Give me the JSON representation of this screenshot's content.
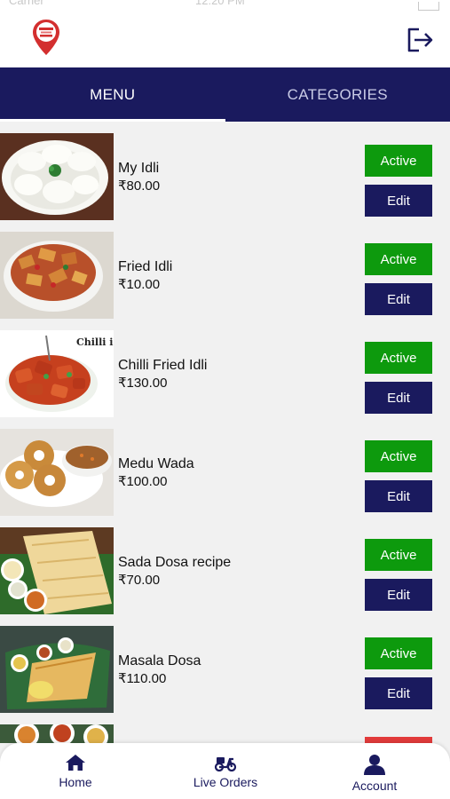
{
  "status_bar": {
    "carrier": "Carrier",
    "time": "12:20 PM"
  },
  "header": {
    "logo_icon": "map-pin-logo-icon",
    "logout_icon": "logout-icon"
  },
  "tabs": [
    {
      "label": "MENU",
      "active": true
    },
    {
      "label": "CATEGORIES",
      "active": false
    }
  ],
  "menu_items": [
    {
      "name": "My Idli",
      "price": "₹80.00",
      "status": "Active",
      "edit": "Edit"
    },
    {
      "name": "Fried Idli",
      "price": "₹10.00",
      "status": "Active",
      "edit": "Edit"
    },
    {
      "name": "Chilli Fried Idli",
      "price": "₹130.00",
      "status": "Active",
      "edit": "Edit",
      "image_caption": "Chilli idli"
    },
    {
      "name": "Medu Wada",
      "price": "₹100.00",
      "status": "Active",
      "edit": "Edit"
    },
    {
      "name": "Sada Dosa recipe",
      "price": "₹70.00",
      "status": "Active",
      "edit": "Edit"
    },
    {
      "name": "Masala Dosa",
      "price": "₹110.00",
      "status": "Active",
      "edit": "Edit"
    }
  ],
  "bottom_nav": [
    {
      "label": "Home",
      "icon": "home-icon"
    },
    {
      "label": "Live Orders",
      "icon": "scooter-icon"
    },
    {
      "label": "Account",
      "icon": "person-icon"
    }
  ],
  "colors": {
    "navy": "#1a1a5e",
    "active_green": "#0d9a0d",
    "danger_red": "#e23b3b",
    "background": "#f1f1f1"
  }
}
